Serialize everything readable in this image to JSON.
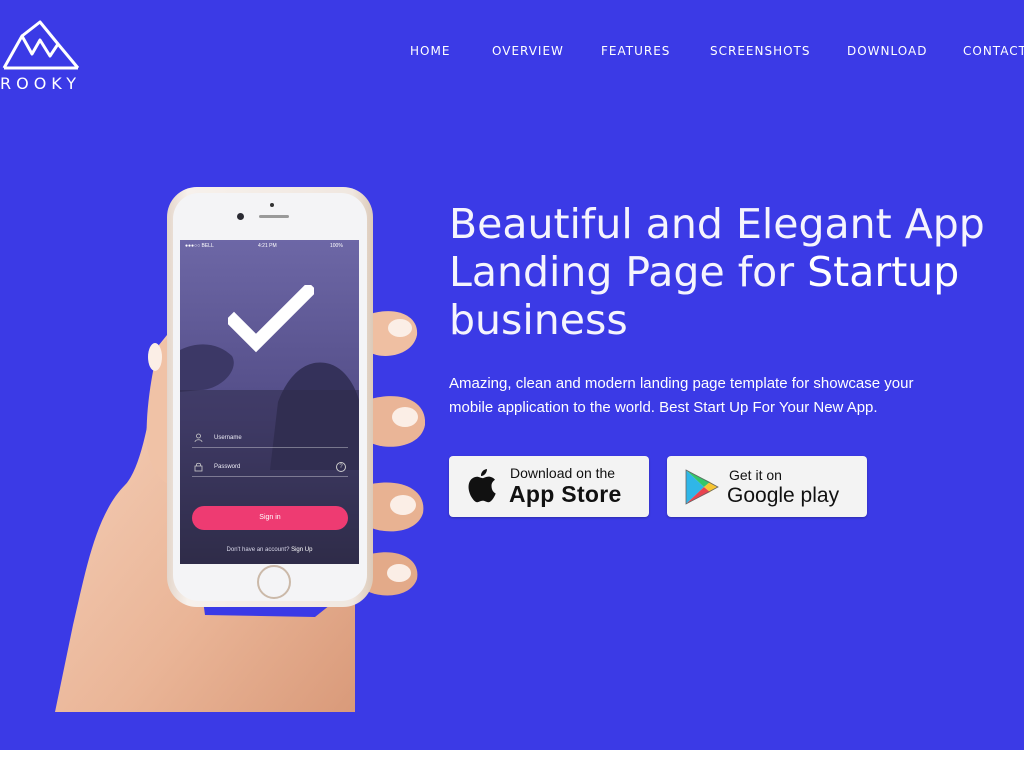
{
  "brand": {
    "name": "ROOKY"
  },
  "nav": {
    "items": [
      "HOME",
      "OVERVIEW",
      "FEATURES",
      "SCREENSHOTS",
      "DOWNLOAD",
      "CONTACT"
    ]
  },
  "hero": {
    "headline_part1": "Beautiful and Elegant App Landing Page for ",
    "headline_strong": "Startup",
    "headline_part2": " business",
    "subtext": "Amazing, clean and modern landing page template for showcase your mobile application to the world. Best Start Up For Your New App.",
    "background_color": "#3b3ae6"
  },
  "store_buttons": {
    "appstore": {
      "small": "Download on the",
      "big": "App Store",
      "icon": "apple-icon"
    },
    "googleplay": {
      "small": "Get it on",
      "big": "Google play",
      "icon": "google-play-icon"
    }
  },
  "phone_screen": {
    "carrier": "●●●○○ BELL",
    "time": "4:21 PM",
    "battery": "100%",
    "username_placeholder": "Username",
    "password_placeholder": "Password",
    "help_label": "?",
    "signin_label": "Sign in",
    "signup_prompt": "Don't have an account?",
    "signup_link": "Sign Up",
    "accent_color": "#ee3b72"
  }
}
